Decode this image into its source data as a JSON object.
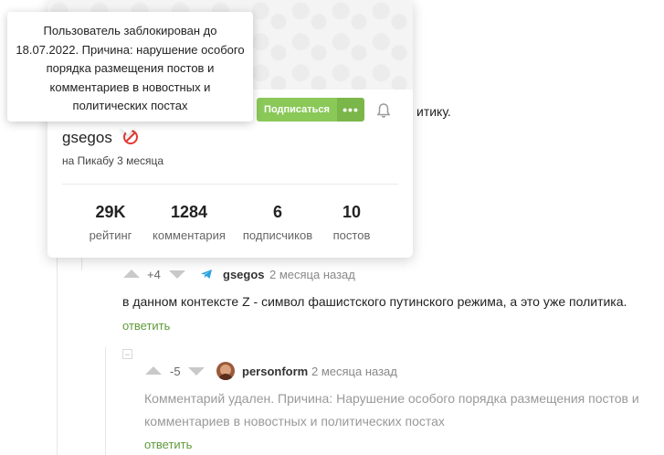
{
  "background_comment": {
    "text_fragment": "итику."
  },
  "profile_card": {
    "username": "gsegos",
    "joined": "на Пикабу 3 месяца",
    "subscribe_label": "Подписаться",
    "more_label": "•••",
    "stats": [
      {
        "value": "29K",
        "label": "рейтинг"
      },
      {
        "value": "1284",
        "label": "комментария"
      },
      {
        "value": "6",
        "label": "подписчиков"
      },
      {
        "value": "10",
        "label": "постов"
      }
    ]
  },
  "tooltip": {
    "text": "Пользователь заблокирован до 18.07.2022. Причина: нарушение особого порядка размещения постов и комментариев в новостных и политических постах"
  },
  "comments": [
    {
      "rating": "+4",
      "username": "gsegos",
      "time": "2 месяца назад",
      "text": "в данном контексте Z - символ фашистского путинского режима, а это уже политика.",
      "reply_label": "ответить"
    },
    {
      "collapse_label": "−",
      "rating": "-5",
      "username": "personform",
      "time": "2 месяца назад",
      "text_line1": "Комментарий удален. Причина: Нарушение особого порядка размещения постов и",
      "text_line2": "комментариев в новостных и политических постах",
      "reply_label": "ответить"
    }
  ],
  "colors": {
    "accent_green": "#8ac858",
    "reply_green": "#5f9a3a",
    "ban_red": "#e53935",
    "telegram_blue": "#2aa3df"
  }
}
